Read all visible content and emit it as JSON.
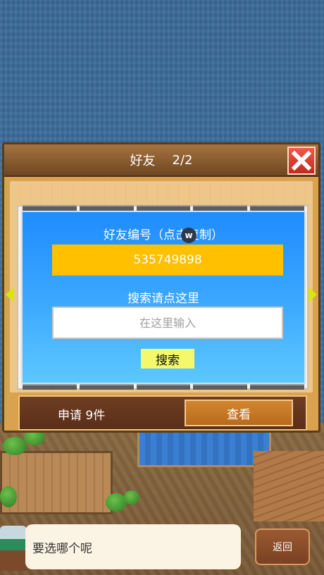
{
  "dialog": {
    "title": "好友",
    "page": "2/2",
    "close_icon": "close-x-icon"
  },
  "friend_panel": {
    "id_label": "好友编号（点击复制）",
    "friend_id": "535749898",
    "search_label": "搜索请点这里",
    "search_placeholder": "在这里输入",
    "search_value": "",
    "search_button": "搜索",
    "badge": "w"
  },
  "request_bar": {
    "text": "申请 9件",
    "view_button": "查看"
  },
  "footer": {
    "message": "要选哪个呢",
    "back_button": "返回"
  },
  "colors": {
    "panel_blue": "#1f8cff",
    "id_box_yellow": "#ffc000",
    "search_button_yellow": "#f4f86a",
    "dialog_wood": "#d9a24e",
    "close_red": "#e0463a"
  }
}
